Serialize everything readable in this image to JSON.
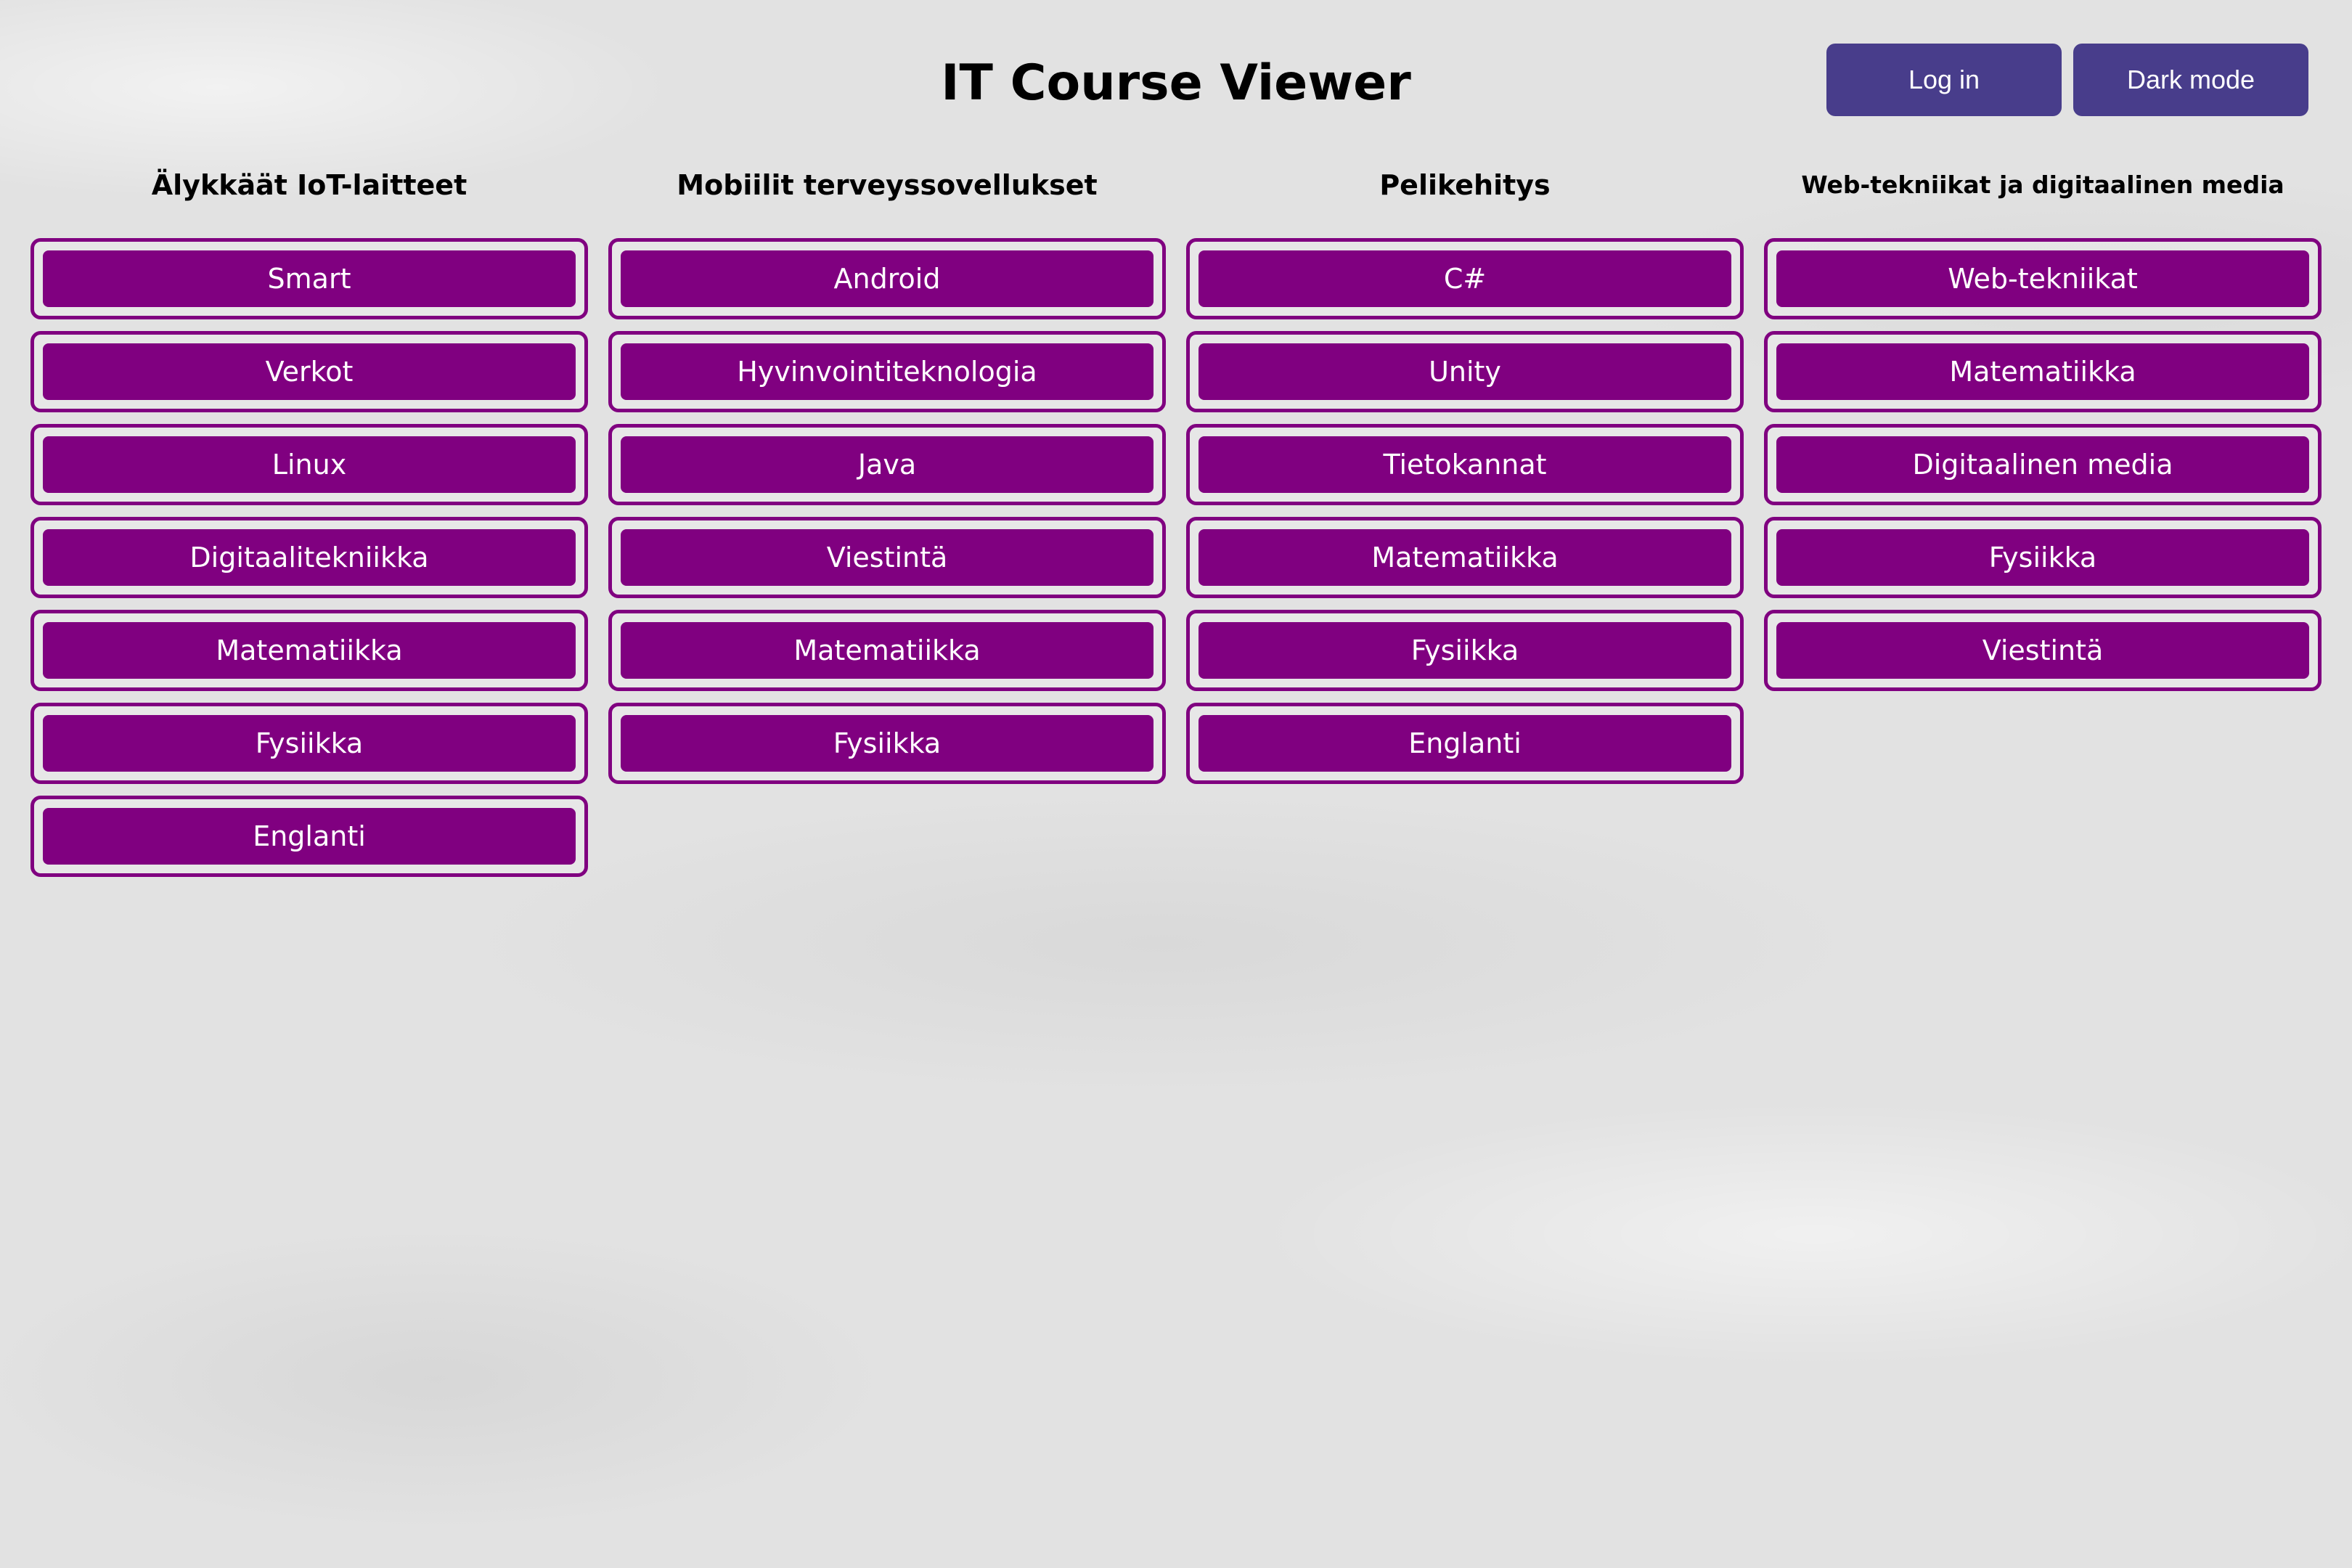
{
  "header": {
    "title": "IT Course Viewer",
    "login_label": "Log in",
    "darkmode_label": "Dark mode"
  },
  "colors": {
    "course_button": "#800080",
    "top_button": "#483d8b",
    "background": "#e2e2e2"
  },
  "columns": [
    {
      "title": "Älykkäät IoT-laitteet",
      "courses": [
        "Smart",
        "Verkot",
        "Linux",
        "Digitaalitekniikka",
        "Matematiikka",
        "Fysiikka",
        "Englanti"
      ]
    },
    {
      "title": "Mobiilit terveyssovellukset",
      "courses": [
        "Android",
        "Hyvinvointiteknologia",
        "Java",
        "Viestintä",
        "Matematiikka",
        "Fysiikka"
      ]
    },
    {
      "title": "Pelikehitys",
      "courses": [
        "C#",
        "Unity",
        "Tietokannat",
        "Matematiikka",
        "Fysiikka",
        "Englanti"
      ]
    },
    {
      "title": "Web-tekniikat ja digitaalinen media",
      "courses": [
        "Web-tekniikat",
        "Matematiikka",
        "Digitaalinen media",
        "Fysiikka",
        "Viestintä"
      ]
    }
  ]
}
